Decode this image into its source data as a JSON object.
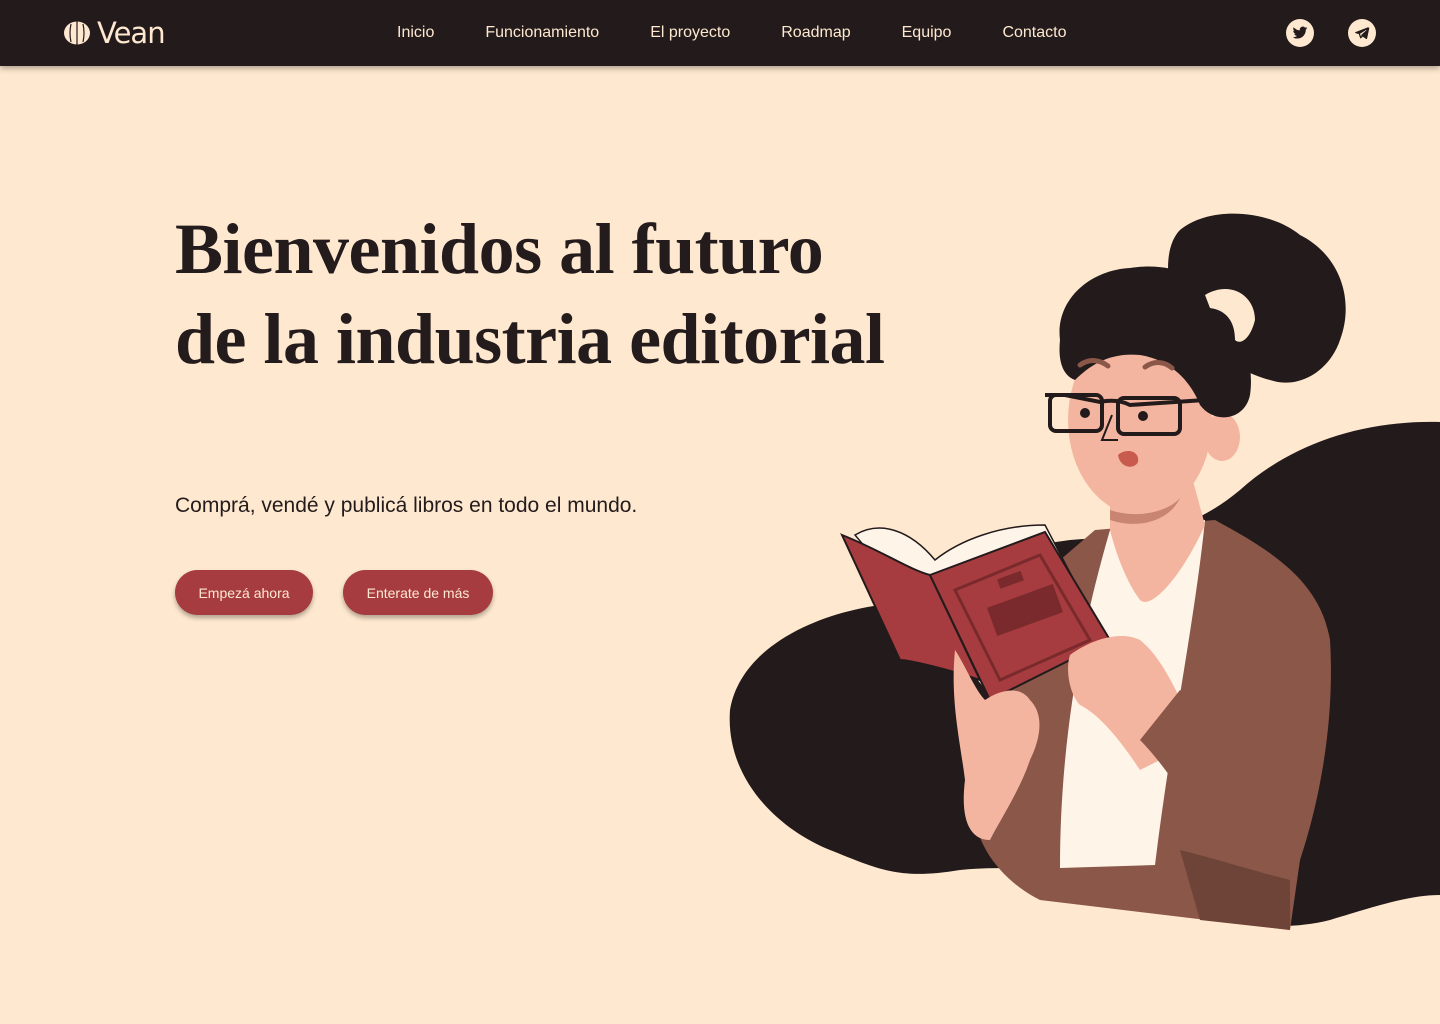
{
  "brand": {
    "name": "Vean"
  },
  "nav": {
    "items": [
      {
        "label": "Inicio"
      },
      {
        "label": "Funcionamiento"
      },
      {
        "label": "El proyecto"
      },
      {
        "label": "Roadmap"
      },
      {
        "label": "Equipo"
      },
      {
        "label": "Contacto"
      }
    ]
  },
  "social": [
    {
      "icon": "twitter-icon"
    },
    {
      "icon": "telegram-icon"
    }
  ],
  "hero": {
    "title": "Bienvenidos al futuro de la industria editorial",
    "subtitle": "Comprá, vendé y publicá libros en todo el mundo.",
    "primary_button": "Empezá ahora",
    "secondary_button": "Enterate de más"
  },
  "colors": {
    "background": "#fee8cf",
    "navbar": "#221a1b",
    "accent": "#a63c3f",
    "text": "#231b1c"
  }
}
